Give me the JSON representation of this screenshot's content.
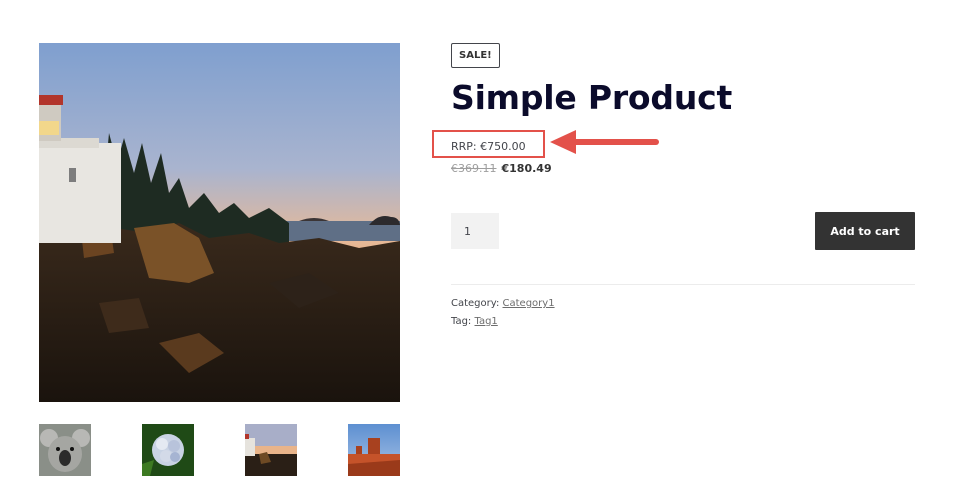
{
  "gallery": {
    "main_image": "lighthouse-coast-sunset",
    "thumbnails": [
      "koala",
      "hydrangea-flower",
      "lighthouse-coast-sunset",
      "desert-monument-valley"
    ]
  },
  "product": {
    "sale_badge": "SALE!",
    "title": "Simple Product",
    "rrp": "RRP: €750.00",
    "price_regular": "€369.11",
    "price_sale": "€180.49",
    "quantity": "1",
    "add_to_cart_label": "Add to cart",
    "category_label": "Category:",
    "category_value": "Category1",
    "tag_label": "Tag:",
    "tag_value": "Tag1"
  },
  "colors": {
    "highlight": "#e3514a",
    "button": "#333333",
    "title": "#0b0b2b"
  }
}
